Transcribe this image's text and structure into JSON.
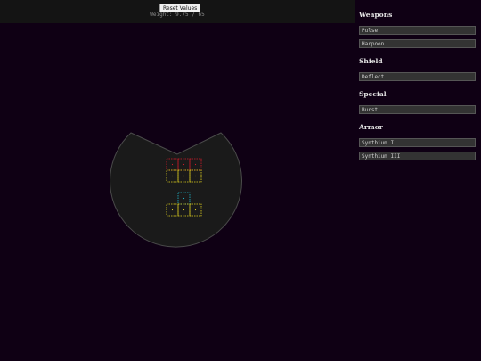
{
  "toolbar": {
    "reset_label": "Reset Values",
    "weight_label": "Weight:",
    "weight_current": "9.75",
    "weight_separator": "/",
    "weight_max": "65"
  },
  "panel": {
    "sections": [
      {
        "title": "Weapons",
        "slots": [
          "Pulse",
          "Harpoon"
        ]
      },
      {
        "title": "Shield",
        "slots": [
          "Deflect"
        ]
      },
      {
        "title": "Special",
        "slots": [
          "Burst"
        ]
      },
      {
        "title": "Armor",
        "slots": [
          "Synthium I",
          "Synthium III"
        ]
      }
    ]
  },
  "ship": {
    "hull_color": "#1a1a1a",
    "hull_outline": "#4a4a4a",
    "modules": [
      {
        "kind": "weapon",
        "color": "#d21a2a"
      },
      {
        "kind": "weapon",
        "color": "#d21a2a"
      },
      {
        "kind": "weapon",
        "color": "#d21a2a"
      },
      {
        "kind": "armor",
        "color": "#e1d21e"
      },
      {
        "kind": "armor",
        "color": "#e1d21e"
      },
      {
        "kind": "armor",
        "color": "#e1d21e"
      },
      {
        "kind": "shield",
        "color": "#1eb4c8"
      },
      {
        "kind": "armor",
        "color": "#e1d21e"
      },
      {
        "kind": "armor",
        "color": "#e1d21e"
      },
      {
        "kind": "armor",
        "color": "#e1d21e"
      }
    ]
  }
}
